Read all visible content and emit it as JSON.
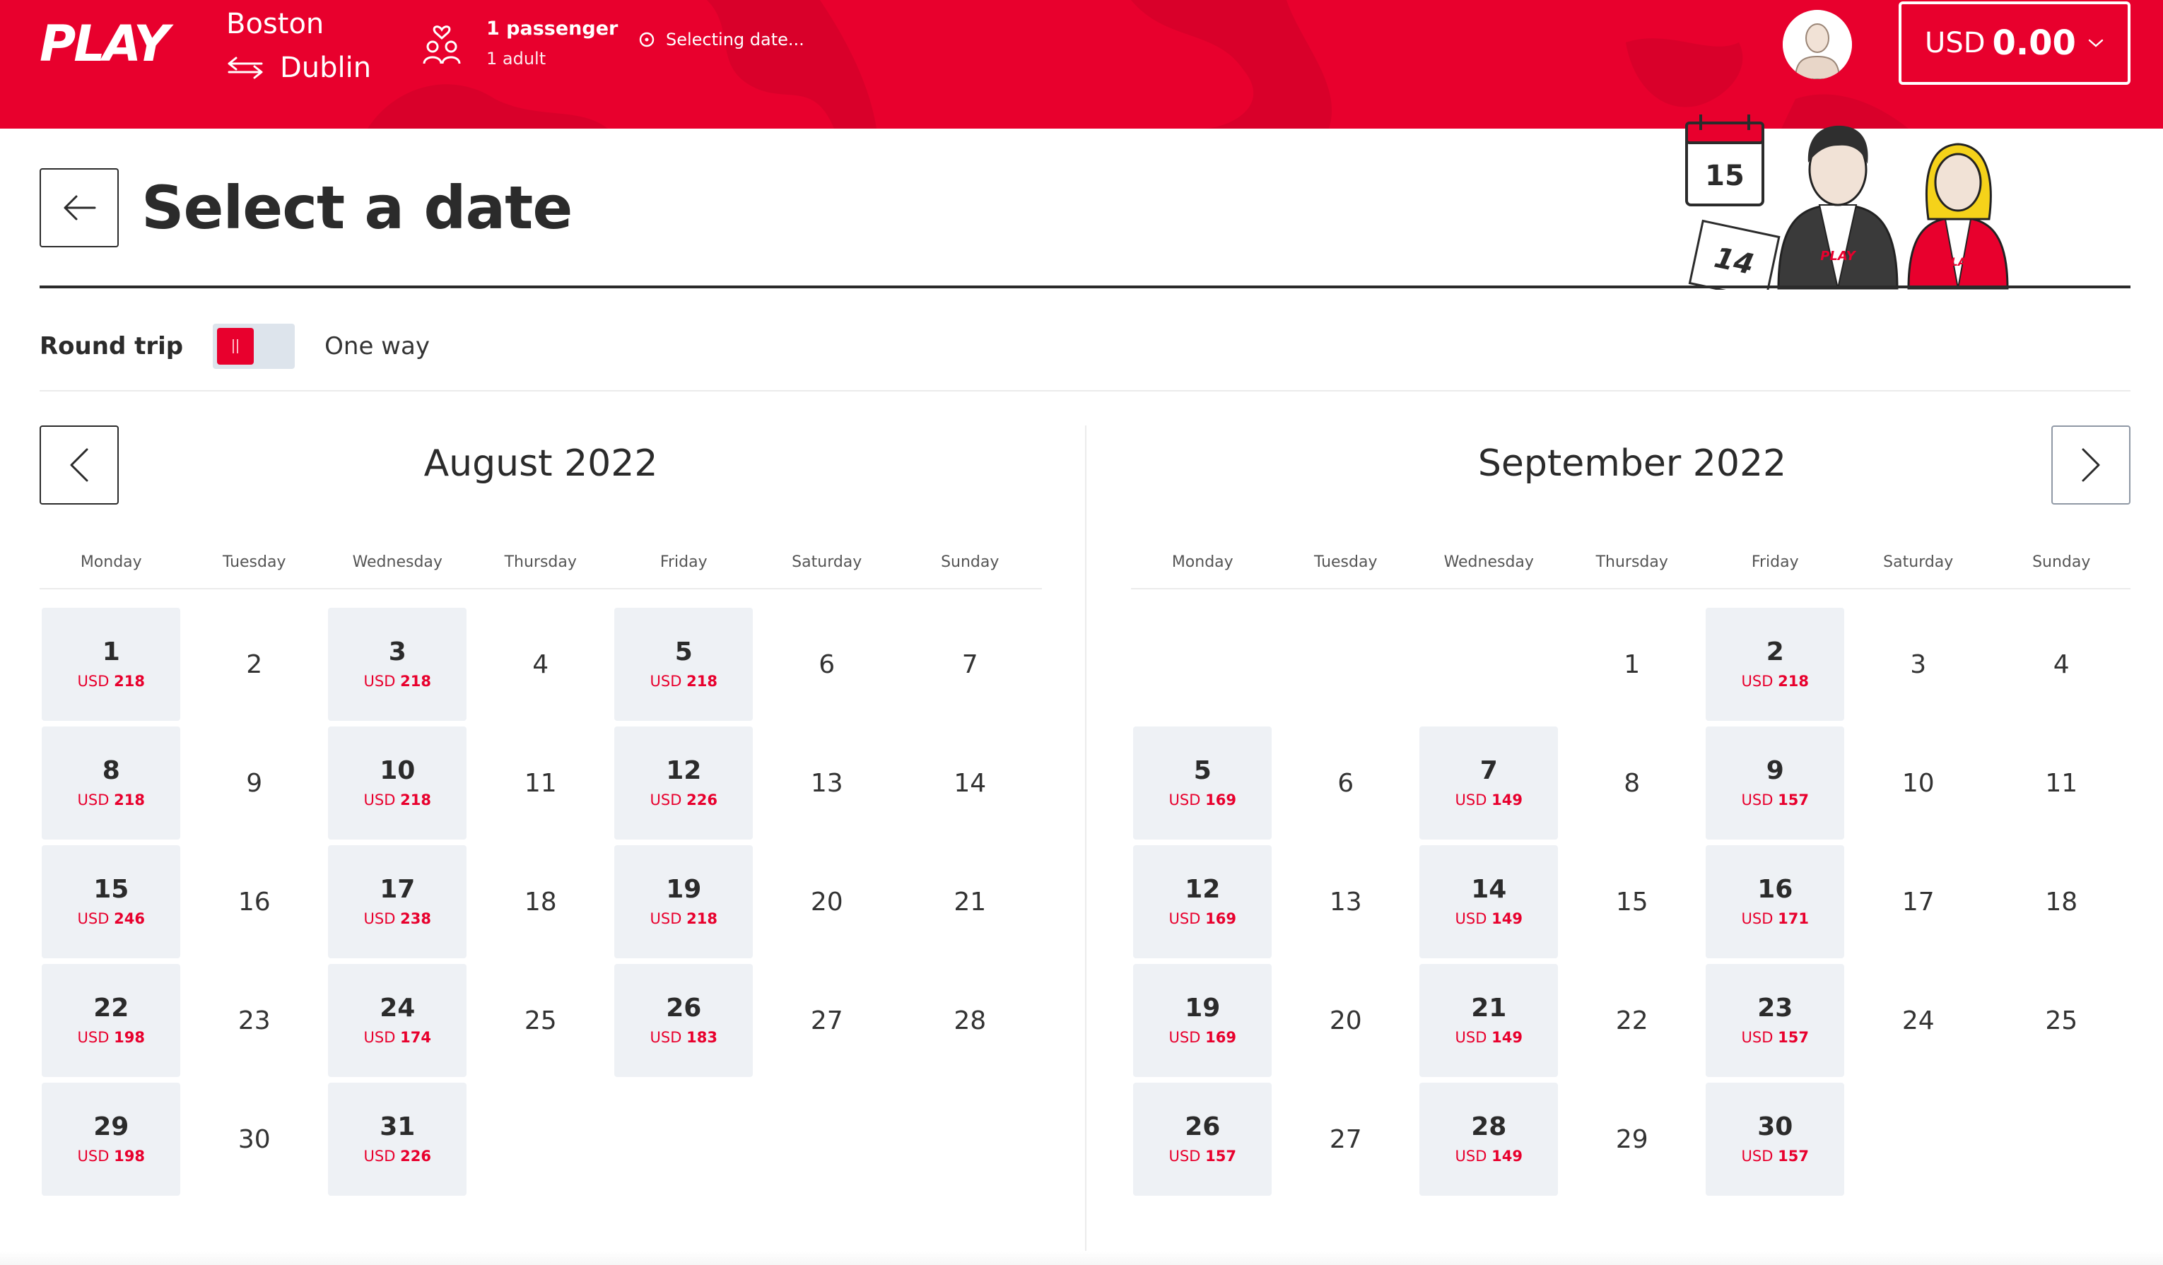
{
  "header": {
    "logo": "PLAY",
    "route": {
      "origin": "Boston",
      "destination": "Dublin"
    },
    "passengers": {
      "title": "1 passenger",
      "detail": "1 adult"
    },
    "status": "Selecting date...",
    "currency": {
      "code": "USD",
      "amount": "0.00"
    }
  },
  "page": {
    "title": "Select a date",
    "illustration": {
      "calendar_front": "15",
      "calendar_back": "14",
      "shirt_text": "PLAY"
    }
  },
  "trip": {
    "round_trip_label": "Round trip",
    "one_way_label": "One way",
    "round_trip_selected": true
  },
  "colors": {
    "brand": "#e8002d",
    "available_bg": "#eef1f5",
    "price": "#e8002d",
    "text": "#2b2b2b"
  },
  "calendars": [
    {
      "title": "August 2022",
      "weekdays": [
        "Monday",
        "Tuesday",
        "Wednesday",
        "Thursday",
        "Friday",
        "Saturday",
        "Sunday"
      ],
      "days": [
        {
          "d": "1",
          "price": "218"
        },
        {
          "d": "2"
        },
        {
          "d": "3",
          "price": "218"
        },
        {
          "d": "4"
        },
        {
          "d": "5",
          "price": "218"
        },
        {
          "d": "6"
        },
        {
          "d": "7"
        },
        {
          "d": "8",
          "price": "218"
        },
        {
          "d": "9"
        },
        {
          "d": "10",
          "price": "218"
        },
        {
          "d": "11"
        },
        {
          "d": "12",
          "price": "226"
        },
        {
          "d": "13"
        },
        {
          "d": "14"
        },
        {
          "d": "15",
          "price": "246"
        },
        {
          "d": "16"
        },
        {
          "d": "17",
          "price": "238"
        },
        {
          "d": "18"
        },
        {
          "d": "19",
          "price": "218"
        },
        {
          "d": "20"
        },
        {
          "d": "21"
        },
        {
          "d": "22",
          "price": "198"
        },
        {
          "d": "23"
        },
        {
          "d": "24",
          "price": "174"
        },
        {
          "d": "25"
        },
        {
          "d": "26",
          "price": "183"
        },
        {
          "d": "27"
        },
        {
          "d": "28"
        },
        {
          "d": "29",
          "price": "198"
        },
        {
          "d": "30"
        },
        {
          "d": "31",
          "price": "226"
        }
      ]
    },
    {
      "title": "September 2022",
      "weekdays": [
        "Monday",
        "Tuesday",
        "Wednesday",
        "Thursday",
        "Friday",
        "Saturday",
        "Sunday"
      ],
      "days": [
        {},
        {},
        {},
        {
          "d": "1"
        },
        {
          "d": "2",
          "price": "218"
        },
        {
          "d": "3"
        },
        {
          "d": "4"
        },
        {
          "d": "5",
          "price": "169"
        },
        {
          "d": "6"
        },
        {
          "d": "7",
          "price": "149"
        },
        {
          "d": "8"
        },
        {
          "d": "9",
          "price": "157"
        },
        {
          "d": "10"
        },
        {
          "d": "11"
        },
        {
          "d": "12",
          "price": "169"
        },
        {
          "d": "13"
        },
        {
          "d": "14",
          "price": "149"
        },
        {
          "d": "15"
        },
        {
          "d": "16",
          "price": "171"
        },
        {
          "d": "17"
        },
        {
          "d": "18"
        },
        {
          "d": "19",
          "price": "169"
        },
        {
          "d": "20"
        },
        {
          "d": "21",
          "price": "149"
        },
        {
          "d": "22"
        },
        {
          "d": "23",
          "price": "157"
        },
        {
          "d": "24"
        },
        {
          "d": "25"
        },
        {
          "d": "26",
          "price": "157"
        },
        {
          "d": "27"
        },
        {
          "d": "28",
          "price": "149"
        },
        {
          "d": "29"
        },
        {
          "d": "30",
          "price": "157"
        }
      ]
    }
  ],
  "price_currency": "USD",
  "icons": [
    "swap-arrows-icon",
    "passengers-icon",
    "clock-icon",
    "avatar-icon",
    "chevron-down-icon",
    "arrow-left-icon",
    "chevron-left-icon",
    "chevron-right-icon"
  ]
}
